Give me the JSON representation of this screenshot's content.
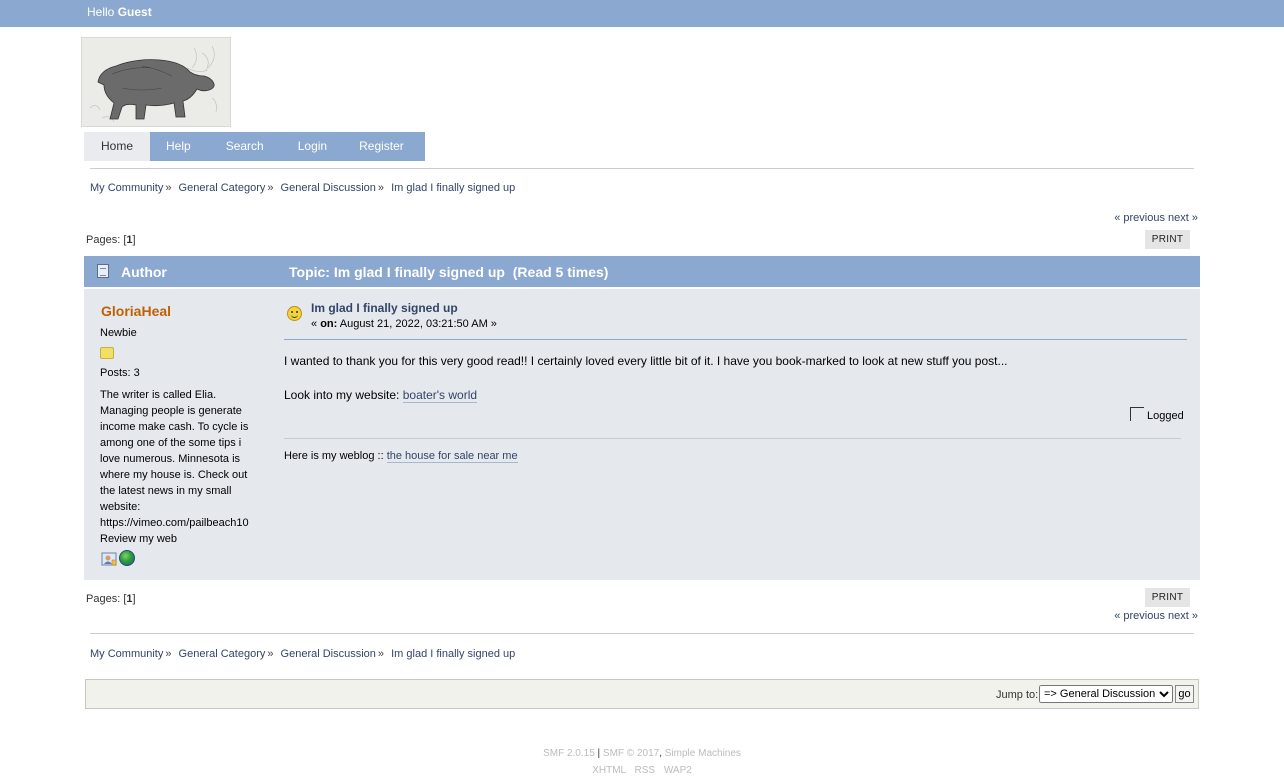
{
  "user_bar": {
    "hello": "Hello",
    "username": "Guest"
  },
  "menu": [
    {
      "label": "Home"
    },
    {
      "label": "Help"
    },
    {
      "label": "Search"
    },
    {
      "label": "Login"
    },
    {
      "label": "Register"
    }
  ],
  "breadcrumb": {
    "items": [
      "My Community",
      "General Category",
      "General Discussion",
      "Im glad I finally signed up"
    ],
    "separator": "»"
  },
  "nav": {
    "previous": "« previous",
    "next": "next »"
  },
  "pages": {
    "label": "Pages:",
    "open": "[",
    "current": "1",
    "close": "]"
  },
  "print_label": "PRINT",
  "header": {
    "author": "Author",
    "topic": "Topic: Im glad I finally signed up  (Read 5 times)"
  },
  "poster": {
    "name": "GloriaHeal",
    "rank": "Newbie",
    "posts": "Posts: 3",
    "blurb": "The writer is called Elia. Managing people is generate income make cash. To cycle is among one of the some tips i love numerous. Minnesota is where my house is. Check out the latest news in my small website: https://vimeo.com/pailbeach10 Review my web"
  },
  "post": {
    "subject": "Im glad I finally signed up",
    "date_prefix": "« ",
    "date_on": "on:",
    "date_value": " August 21, 2022, 03:21:50 AM »",
    "body_line1": "I wanted to thank you for this very good read!! I certainly loved every little bit of it. I have you book-marked to look at new stuff you post...",
    "body_line2_prefix": "Look into my website: ",
    "body_link": "boater's world",
    "logged": "Logged",
    "sig_prefix": "Here is my weblog :: ",
    "sig_link": "the house for sale near me"
  },
  "jump": {
    "label": "Jump to:",
    "selected": "=> General Discussion",
    "go": "go"
  },
  "footer": {
    "smf_version": "SMF 2.0.15",
    "pipe": " | ",
    "smf_copy": "SMF © 2017",
    "comma": ", ",
    "simple_machines": "Simple Machines",
    "links": [
      "XHTML",
      "RSS",
      "WAP2"
    ]
  },
  "colors": {
    "bar_blue": "#8ba8d0",
    "post_bg": "#e5e9ee",
    "author_name": "#c06002",
    "link": "#334466"
  }
}
